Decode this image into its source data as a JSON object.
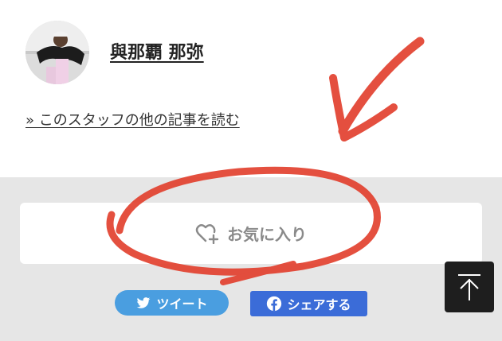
{
  "author": {
    "name": "與那覇 那弥",
    "more_articles_link": "» このスタッフの他の記事を読む"
  },
  "favorite": {
    "label": "お気に入り",
    "icon": "heart-plus-icon"
  },
  "share": {
    "tweet_label": "ツイート",
    "tweet_icon": "twitter-bird-icon",
    "facebook_label": "シェアする",
    "facebook_icon": "facebook-icon"
  },
  "back_to_top": {
    "icon": "arrow-up-to-top-icon"
  },
  "colors": {
    "section_gray": "#e6e6e6",
    "favorite_text": "#8a8a8a",
    "twitter_blue": "#4a9ee0",
    "facebook_blue": "#3b6cd8",
    "back_to_top_bg": "#1e1e1e",
    "annotation_red": "#e2412f"
  }
}
